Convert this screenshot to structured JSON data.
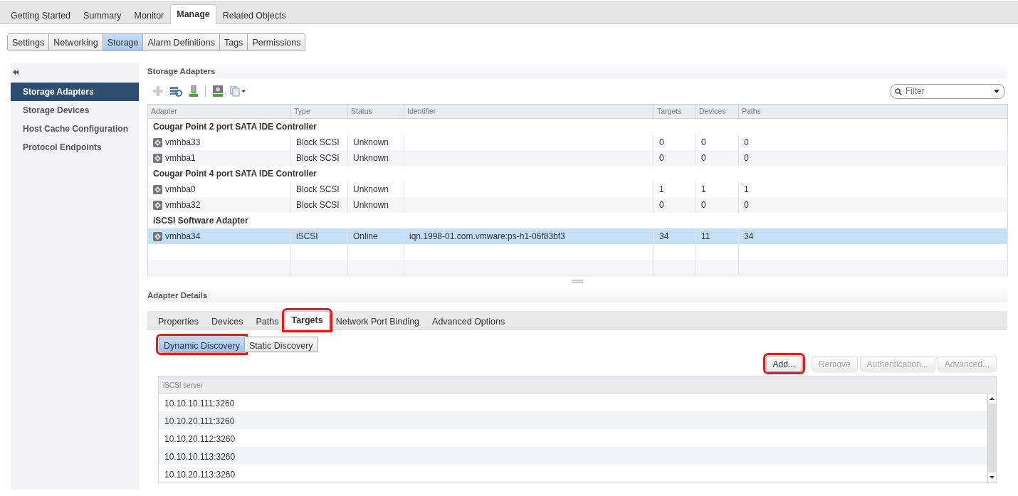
{
  "top_tabs": [
    {
      "label": "Getting Started",
      "selected": false
    },
    {
      "label": "Summary",
      "selected": false
    },
    {
      "label": "Monitor",
      "selected": false
    },
    {
      "label": "Manage",
      "selected": true
    },
    {
      "label": "Related Objects",
      "selected": false
    }
  ],
  "sub_tabs": [
    {
      "label": "Settings",
      "selected": false
    },
    {
      "label": "Networking",
      "selected": false
    },
    {
      "label": "Storage",
      "selected": true
    },
    {
      "label": "Alarm Definitions",
      "selected": false
    },
    {
      "label": "Tags",
      "selected": false
    },
    {
      "label": "Permissions",
      "selected": false
    }
  ],
  "sidebar": {
    "items": [
      {
        "label": "Storage Adapters",
        "selected": true
      },
      {
        "label": "Storage Devices",
        "selected": false
      },
      {
        "label": "Host Cache Configuration",
        "selected": false
      },
      {
        "label": "Protocol Endpoints",
        "selected": false
      }
    ]
  },
  "storage_adapters": {
    "title": "Storage Adapters",
    "filter": {
      "placeholder": "Filter"
    },
    "columns": [
      "Adapter",
      "Type",
      "Status",
      "Identifier",
      "Targets",
      "Devices",
      "Paths"
    ],
    "rows": [
      {
        "kind": "group",
        "label": "Cougar Point 2 port SATA IDE Controller"
      },
      {
        "kind": "adapter",
        "cells": [
          "vmhba33",
          "Block SCSI",
          "Unknown",
          "",
          "0",
          "0",
          "0"
        ],
        "selected": false
      },
      {
        "kind": "adapter",
        "cells": [
          "vmhba1",
          "Block SCSI",
          "Unknown",
          "",
          "0",
          "0",
          "0"
        ],
        "selected": false
      },
      {
        "kind": "group",
        "label": "Cougar Point 4 port SATA IDE Controller"
      },
      {
        "kind": "adapter",
        "cells": [
          "vmhba0",
          "Block SCSI",
          "Unknown",
          "",
          "1",
          "1",
          "1"
        ],
        "selected": false
      },
      {
        "kind": "adapter",
        "cells": [
          "vmhba32",
          "Block SCSI",
          "Unknown",
          "",
          "0",
          "0",
          "0"
        ],
        "selected": false
      },
      {
        "kind": "group",
        "label": "iSCSI Software Adapter"
      },
      {
        "kind": "adapter",
        "cells": [
          "vmhba34",
          "iSCSI",
          "Online",
          "iqn.1998-01.com.vmware:ps-h1-06f83bf3",
          "34",
          "11",
          "34"
        ],
        "selected": true
      }
    ]
  },
  "adapter_details": {
    "title": "Adapter Details",
    "tabs": [
      {
        "label": "Properties",
        "selected": false,
        "highlighted": false
      },
      {
        "label": "Devices",
        "selected": false,
        "highlighted": false
      },
      {
        "label": "Paths",
        "selected": false,
        "highlighted": false
      },
      {
        "label": "Targets",
        "selected": true,
        "highlighted": true
      },
      {
        "label": "Network Port Binding",
        "selected": false,
        "highlighted": false
      },
      {
        "label": "Advanced Options",
        "selected": false,
        "highlighted": false
      }
    ],
    "discovery_tabs": [
      {
        "label": "Dynamic Discovery",
        "selected": true,
        "highlighted": true
      },
      {
        "label": "Static Discovery",
        "selected": false,
        "highlighted": false
      }
    ],
    "buttons": [
      {
        "label": "Add...",
        "disabled": false,
        "highlighted": true
      },
      {
        "label": "Remove",
        "disabled": true,
        "highlighted": false
      },
      {
        "label": "Authentication...",
        "disabled": true,
        "highlighted": false
      },
      {
        "label": "Advanced...",
        "disabled": true,
        "highlighted": false
      }
    ],
    "server_table": {
      "column": "iSCSI server",
      "rows": [
        "10.10.10.111:3260",
        "10.10.20.111:3260",
        "10.10.20.112:3260",
        "10.10.10.113:3260",
        "10.10.20.113:3260"
      ]
    }
  }
}
